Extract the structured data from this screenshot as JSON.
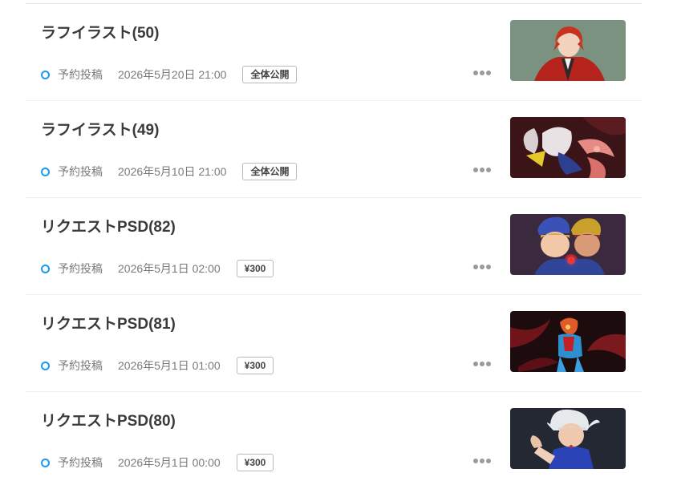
{
  "posts": [
    {
      "title": "ラフイラスト(50)",
      "status": "予約投稿",
      "datetime": "2026年5月20日 21:00",
      "badge": "全体公開",
      "thumbnail_icon": "image-thumbnail-red-hair-boy"
    },
    {
      "title": "ラフイラスト(49)",
      "status": "予約投稿",
      "datetime": "2026年5月10日 21:00",
      "badge": "全体公開",
      "thumbnail_icon": "image-thumbnail-tentacle-girl"
    },
    {
      "title": "リクエストPSD(82)",
      "status": "予約投稿",
      "datetime": "2026年5月1日 02:00",
      "badge": "¥300",
      "thumbnail_icon": "image-thumbnail-armored-pair"
    },
    {
      "title": "リクエストPSD(81)",
      "status": "予約投稿",
      "datetime": "2026年5月1日 01:00",
      "badge": "¥300",
      "thumbnail_icon": "image-thumbnail-red-tentacles"
    },
    {
      "title": "リクエストPSD(80)",
      "status": "予約投稿",
      "datetime": "2026年5月1日 00:00",
      "badge": "¥300",
      "thumbnail_icon": "image-thumbnail-white-hair-fighter"
    }
  ],
  "colors": {
    "status_ring": "#1a9bf0",
    "badge_border": "#b9b9b9"
  }
}
